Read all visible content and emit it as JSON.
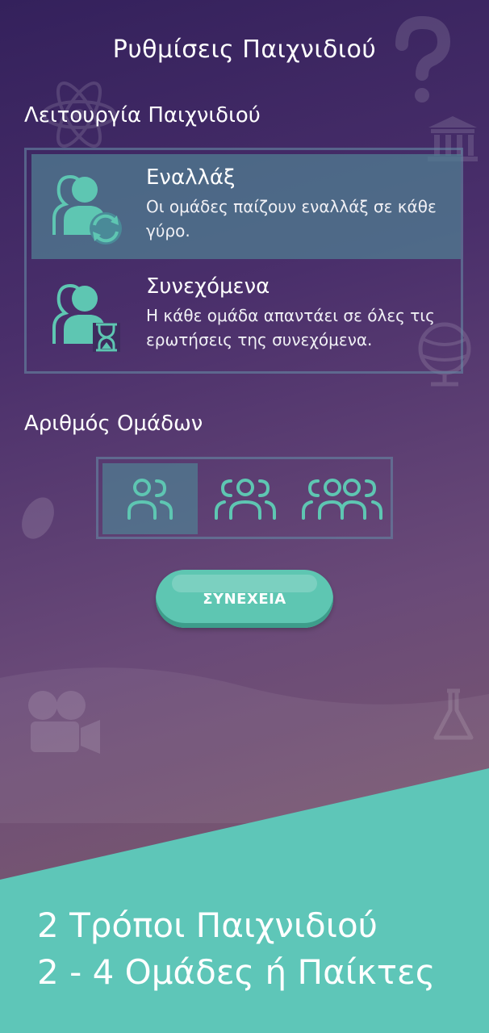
{
  "page": {
    "title": "Ρυθμίσεις Παιχνιδιού"
  },
  "game_mode": {
    "label": "Λειτουργία Παιχνιδιού",
    "options": [
      {
        "name": "Εναλλάξ",
        "description": "Οι ομάδες παίζουν εναλλάξ σε κάθε γύρο.",
        "icon": "team-rotate-icon",
        "selected": true
      },
      {
        "name": "Συνεχόμενα",
        "description": "Η κάθε ομάδα απαντάει σε όλες τις ερωτήσεις της συνεχόμενα.",
        "icon": "team-hourglass-icon",
        "selected": false
      }
    ]
  },
  "team_count": {
    "label": "Αριθμός Ομάδων",
    "options": [
      {
        "icon": "two-teams-icon",
        "value": 2,
        "selected": true
      },
      {
        "icon": "three-teams-icon",
        "value": 3,
        "selected": false
      },
      {
        "icon": "four-teams-icon",
        "value": 4,
        "selected": false
      }
    ]
  },
  "continue_label": "ΣΥΝΕΧΕΙΑ",
  "promo": {
    "line1": "2 Τρόποι Παιχνιδιού",
    "line2": "2 - 4 Ομάδες ή Παίκτες"
  },
  "colors": {
    "accent": "#5ec6b2",
    "panel_selected": "#50798f",
    "bg_top": "#34215c",
    "bg_bottom": "#7b5a6f"
  }
}
